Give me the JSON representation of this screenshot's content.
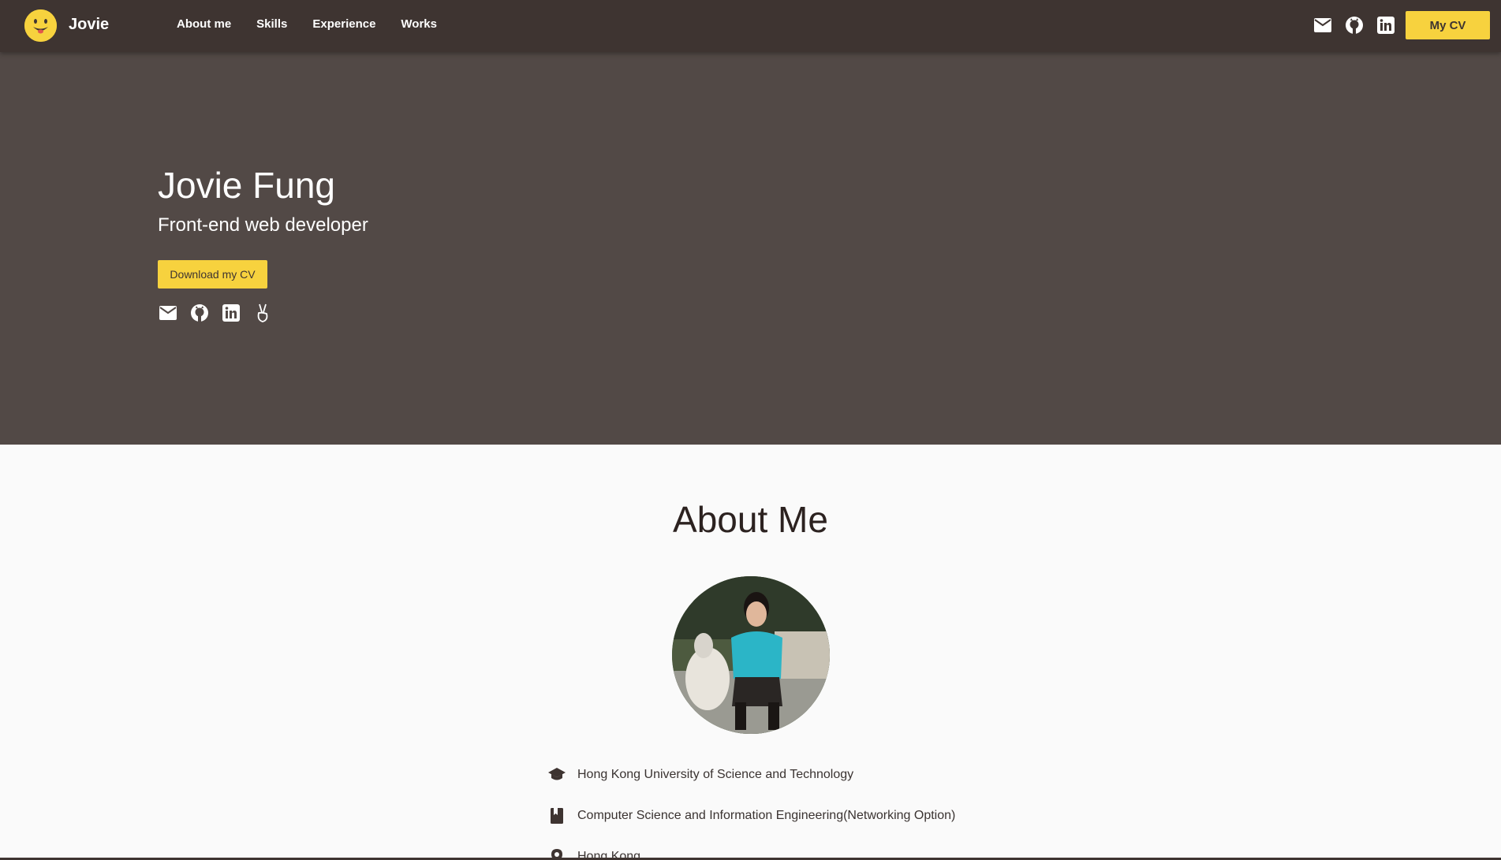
{
  "brand": {
    "name": "Jovie"
  },
  "nav": {
    "items": [
      "About me",
      "Skills",
      "Experience",
      "Works"
    ]
  },
  "header": {
    "cv_button": "My CV"
  },
  "hero": {
    "name": "Jovie Fung",
    "role": "Front-end web developer",
    "download_button": "Download my CV"
  },
  "social_icons": [
    "mail-icon",
    "github-icon",
    "linkedin-icon",
    "angellist-icon"
  ],
  "about": {
    "title": "About Me",
    "items": [
      {
        "icon": "graduation-cap-icon",
        "text": "Hong Kong University of Science and Technology"
      },
      {
        "icon": "book-icon",
        "text": "Computer Science and Information Engineering(Networking Option)"
      },
      {
        "icon": "location-pin-icon",
        "text": "Hong Kong"
      }
    ]
  },
  "colors": {
    "nav_bg": "#3e3431",
    "hero_bg": "#524946",
    "accent": "#f7d23e",
    "page_bg": "#fafafa"
  }
}
